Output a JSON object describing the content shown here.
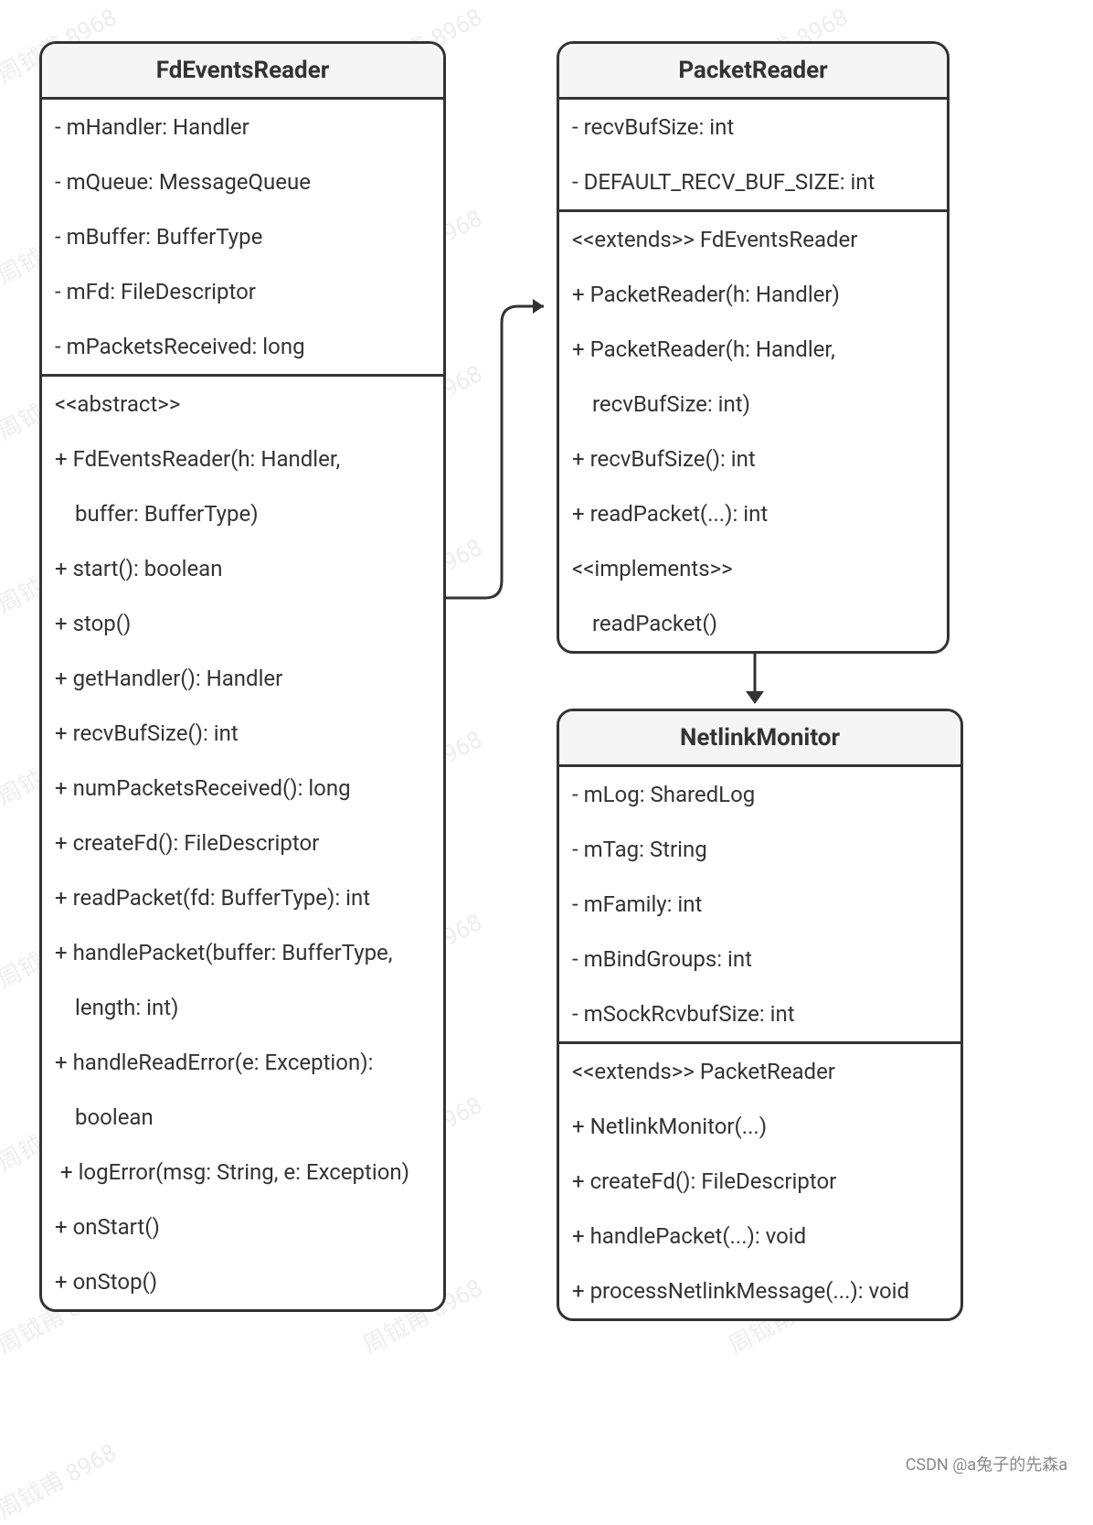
{
  "watermarkText": "周钺甫 8968",
  "footerCredit": "CSDN @a兔子的先森a",
  "classes": {
    "fdEventsReader": {
      "title": "FdEventsReader",
      "attributes": [
        "- mHandler: Handler",
        "- mQueue: MessageQueue",
        "- mBuffer: BufferType",
        "- mFd: FileDescriptor",
        "- mPacketsReceived: long"
      ],
      "operations": [
        "<<abstract>>",
        "+ FdEventsReader(h: Handler,",
        "buffer: BufferType)",
        "+ start(): boolean",
        "+ stop()",
        "+ getHandler(): Handler",
        "+ recvBufSize(): int",
        "+ numPacketsReceived(): long",
        "+ createFd(): FileDescriptor",
        "+ readPacket(fd: BufferType): int",
        "+ handlePacket(buffer: BufferType,",
        "length: int)",
        "+ handleReadError(e: Exception):",
        "boolean",
        " + logError(msg: String, e: Exception)",
        "+ onStart()",
        "+ onStop()"
      ],
      "indentIndices": [
        2,
        11,
        13
      ]
    },
    "packetReader": {
      "title": "PacketReader",
      "attributes": [
        "- recvBufSize: int",
        "- DEFAULT_RECV_BUF_SIZE: int"
      ],
      "operations": [
        "<<extends>> FdEventsReader",
        "+ PacketReader(h: Handler)",
        "+ PacketReader(h: Handler,",
        "recvBufSize: int)",
        "+ recvBufSize(): int",
        "+ readPacket(...): int",
        "<<implements>>",
        "readPacket()"
      ],
      "indentIndices": [
        3,
        7
      ]
    },
    "netlinkMonitor": {
      "title": "NetlinkMonitor",
      "attributes": [
        "- mLog: SharedLog",
        "- mTag: String",
        "- mFamily: int",
        "- mBindGroups: int",
        "- mSockRcvbufSize: int"
      ],
      "operations": [
        "<<extends>> PacketReader",
        "+ NetlinkMonitor(...)",
        "+ createFd(): FileDescriptor",
        "+ handlePacket(...): void",
        "+ processNetlinkMessage(...): void"
      ],
      "indentIndices": []
    }
  }
}
